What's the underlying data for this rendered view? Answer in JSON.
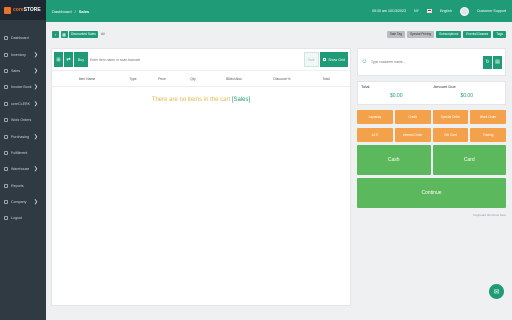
{
  "brand": {
    "name_a": "core",
    "name_b": "STORE"
  },
  "sidebar": {
    "items": [
      {
        "label": "Dashboard",
        "icon": "dashboard-icon",
        "chevron": ""
      },
      {
        "label": "Inventory",
        "icon": "inventory-icon",
        "chevron": "❯"
      },
      {
        "label": "Sales",
        "icon": "sales-icon",
        "chevron": "❯"
      },
      {
        "label": "Invoice Book",
        "icon": "book-icon",
        "chevron": "❯"
      },
      {
        "label": "coreCLERK",
        "icon": "clerk-icon",
        "chevron": "❯"
      },
      {
        "label": "Work Orders",
        "icon": "wrench-icon",
        "chevron": ""
      },
      {
        "label": "Purchasing",
        "icon": "cart-icon",
        "chevron": "❯"
      },
      {
        "label": "Fulfillment",
        "icon": "box-icon",
        "chevron": ""
      },
      {
        "label": "Warehouse",
        "icon": "warehouse-icon",
        "chevron": "❯"
      },
      {
        "label": "Reports",
        "icon": "report-icon",
        "chevron": ""
      },
      {
        "label": "Company",
        "icon": "company-icon",
        "chevron": "❯"
      },
      {
        "label": "Logout",
        "icon": "logout-icon",
        "chevron": ""
      }
    ]
  },
  "topbar": {
    "crumb_root": "Dashboard",
    "crumb_sep": "/",
    "crumb_current": "Sales",
    "datetime": "09:30 am 10/13/2023",
    "location": "NY",
    "language": "English",
    "user": "Customer Support"
  },
  "toolbar": {
    "disc_label": "Discounted Sales",
    "all_label": "All",
    "tabs": [
      "Sale Tag",
      "Special Pricing",
      "Subscriptions",
      "Events/Classes",
      "Tags"
    ]
  },
  "left": {
    "buy_label": "Buy",
    "search_placeholder": "Enter Item name or scan barcode",
    "sale_label": "Sale",
    "grid_label": "Show Grid",
    "columns": [
      "Item Name",
      "Type",
      "Price",
      "Qty",
      "Billed Also",
      "Discount %",
      "Total"
    ],
    "empty_prefix": "There are no items in the cart",
    "empty_tag": "[Sales]"
  },
  "right": {
    "customer_placeholder": "Type customer name...",
    "total_label": "Total",
    "total_value": "$0.00",
    "due_label": "Amount Due",
    "due_value": "$0.00",
    "actions": [
      "Layaway",
      "Credit",
      "Special Order",
      "Work Order",
      "ALTI",
      "Internal Order",
      "Gift Card",
      "Trading"
    ],
    "cash_label": "Cash",
    "card_label": "Card",
    "continue_label": "Continue",
    "shortcuts_label": "Keyboard shortcuts here"
  },
  "colors": {
    "primary": "#1f9c77",
    "accent": "#f3a24b",
    "pay": "#5cb85c",
    "sidebar": "#2f3a43"
  }
}
